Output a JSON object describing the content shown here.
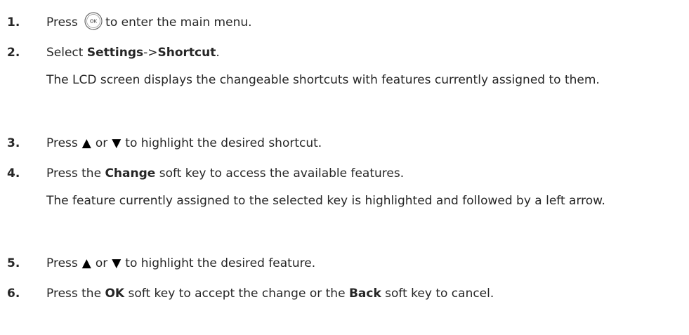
{
  "steps": [
    {
      "num": "1.",
      "pre": "Press",
      "icon": "ok-key-icon",
      "post": "to enter the main menu."
    },
    {
      "num": "2.",
      "pre": "Select",
      "bold1": "Settings",
      "mid": "->",
      "bold2": "Shortcut",
      "post": ".",
      "note": "The LCD screen displays the changeable shortcuts with features currently assigned to them."
    },
    {
      "num": "3.",
      "pre": "Press",
      "up": "▲",
      "or": "or",
      "down": "▼",
      "post": "to highlight the desired shortcut."
    },
    {
      "num": "4.",
      "pre": "Press the",
      "bold1": "Change",
      "post": "soft key to access the available features.",
      "note": "The feature currently assigned to the selected key is highlighted and followed by a left arrow."
    },
    {
      "num": "5.",
      "pre": "Press",
      "up": "▲",
      "or": "or",
      "down": "▼",
      "post": "to highlight the desired feature."
    },
    {
      "num": "6.",
      "pre": "Press the",
      "bold1": "OK",
      "mid": "soft key to accept the change or the",
      "bold2": "Back",
      "post": "soft key to cancel."
    }
  ],
  "icons": {
    "ok_key_label": "OK"
  }
}
